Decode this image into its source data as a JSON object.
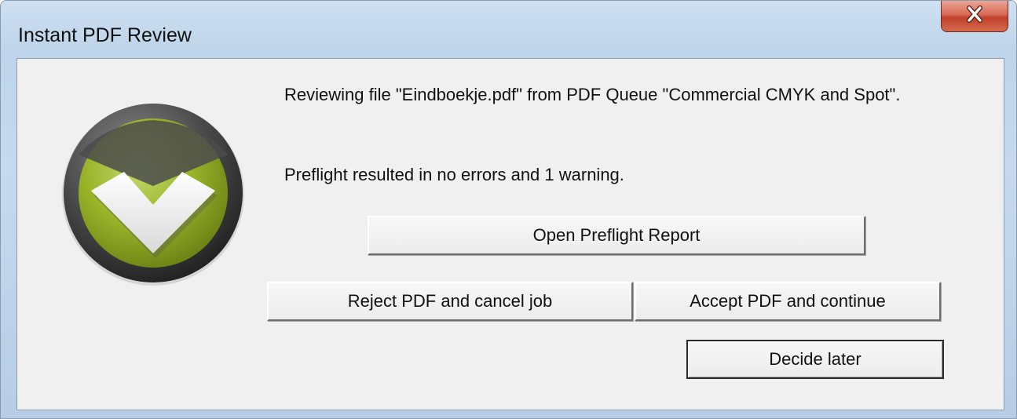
{
  "window": {
    "title": "Instant PDF Review"
  },
  "icons": {
    "close": "close-icon",
    "logo": "checkmark-logo-icon"
  },
  "colors": {
    "logo_green": "#9bb52a",
    "close_red": "#c9452e",
    "dialog_bg": "#f0f0f0"
  },
  "message": {
    "line1": "Reviewing file \"Eindboekje.pdf\" from PDF Queue \"Commercial CMYK and Spot\".",
    "line2": "Preflight resulted in no errors and 1 warning."
  },
  "buttons": {
    "open_report": "Open Preflight Report",
    "reject": "Reject PDF and cancel job",
    "accept": "Accept PDF and continue",
    "decide_later": "Decide later"
  }
}
